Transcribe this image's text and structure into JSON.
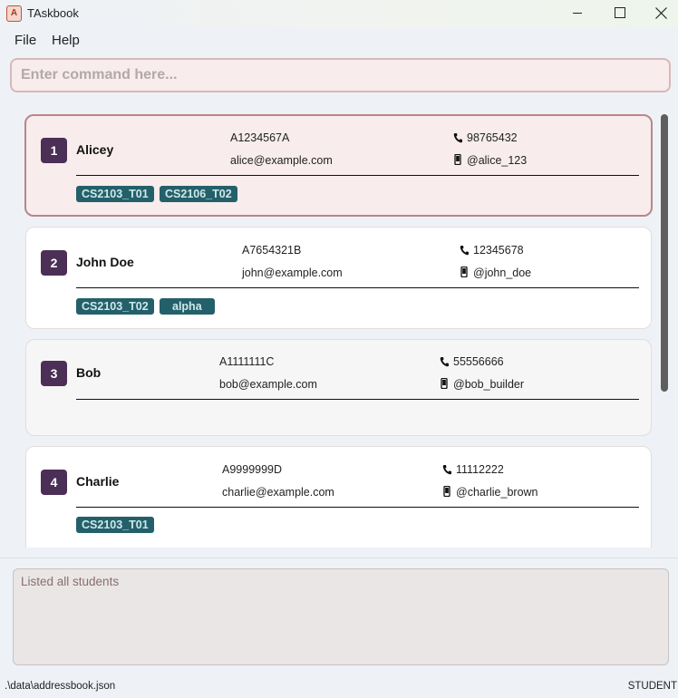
{
  "window": {
    "title": "TAskbook",
    "app_icon_letter": "A"
  },
  "menu": {
    "items": [
      "File",
      "Help"
    ]
  },
  "command": {
    "placeholder": "Enter command here...",
    "value": ""
  },
  "students": [
    {
      "index": "1",
      "name": "Alicey",
      "student_id": "A1234567A",
      "email": "alice@example.com",
      "phone": "98765432",
      "telegram": "@alice_123",
      "tags": [
        "CS2103_T01",
        "CS2106_T02"
      ]
    },
    {
      "index": "2",
      "name": "John Doe",
      "student_id": "A7654321B",
      "email": "john@example.com",
      "phone": "12345678",
      "telegram": "@john_doe",
      "tags": [
        "CS2103_T02",
        "alpha"
      ]
    },
    {
      "index": "3",
      "name": "Bob",
      "student_id": "A1111111C",
      "email": "bob@example.com",
      "phone": "55556666",
      "telegram": "@bob_builder",
      "tags": []
    },
    {
      "index": "4",
      "name": "Charlie",
      "student_id": "A9999999D",
      "email": "charlie@example.com",
      "phone": "11112222",
      "telegram": "@charlie_brown",
      "tags": [
        "CS2103_T01"
      ]
    }
  ],
  "result": {
    "message": "Listed all students"
  },
  "status": {
    "path": ".\\data\\addressbook.json",
    "mode": "STUDENT"
  },
  "colors": {
    "index_badge": "#4b2f56",
    "tag": "#23606a",
    "selected_card": "#f8ecec"
  }
}
